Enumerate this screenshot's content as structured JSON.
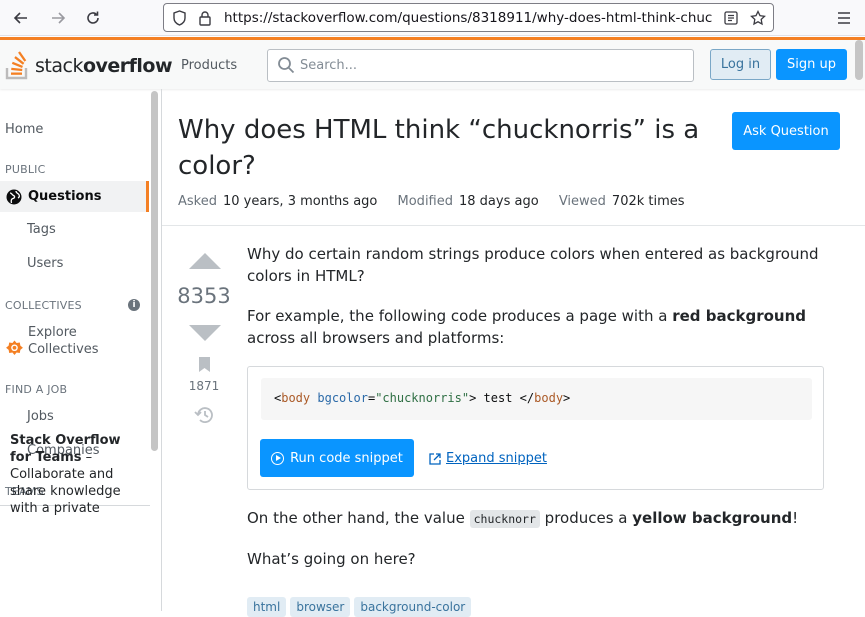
{
  "browser": {
    "url": "https://stackoverflow.com/questions/8318911/why-does-html-think-chuc"
  },
  "header": {
    "logo_plain": "stack",
    "logo_bold": "overflow",
    "products": "Products",
    "search_placeholder": "Search...",
    "login": "Log in",
    "signup": "Sign up"
  },
  "sidebar": {
    "home": "Home",
    "public": "PUBLIC",
    "questions": "Questions",
    "tags": "Tags",
    "users": "Users",
    "collectives": "COLLECTIVES",
    "explore_line1": "Explore",
    "explore_line2": "Collectives",
    "find_job": "FIND A JOB",
    "jobs": "Jobs",
    "companies": "Companies",
    "teams": "TEAMS",
    "teams_bold": "Stack Overflow for Teams",
    "teams_desc": " – Collaborate and share knowledge with a private"
  },
  "question": {
    "title": "Why does HTML think “chucknorris” is a color?",
    "ask_button": "Ask Question",
    "asked_label": "Asked",
    "asked_value": "10 years, 3 months ago",
    "modified_label": "Modified",
    "modified_value": "18 days ago",
    "viewed_label": "Viewed",
    "viewed_value": "702k times",
    "votes": "8353",
    "bookmarks": "1871",
    "p1": "Why do certain random strings produce colors when entered as background colors in HTML?",
    "p2_a": "For example, the following code produces a page with a ",
    "p2_bold": "red background",
    "p2_b": " across all browsers and platforms:",
    "code_open_lt": "<",
    "code_tag": "body",
    "code_attr": "bgcolor",
    "code_eq": "=",
    "code_str": "\"chucknorris\"",
    "code_mid": "> test </",
    "code_tag2": "body",
    "code_close": ">",
    "run_button": "Run code snippet",
    "expand_link": "Expand snippet",
    "p3_a": "On the other hand, the value ",
    "p3_code": "chucknorr",
    "p3_b": " produces a ",
    "p3_bold": "yellow background",
    "p3_c": "!",
    "p4": "What’s going on here?",
    "tags": [
      "html",
      "browser",
      "background-color"
    ]
  }
}
